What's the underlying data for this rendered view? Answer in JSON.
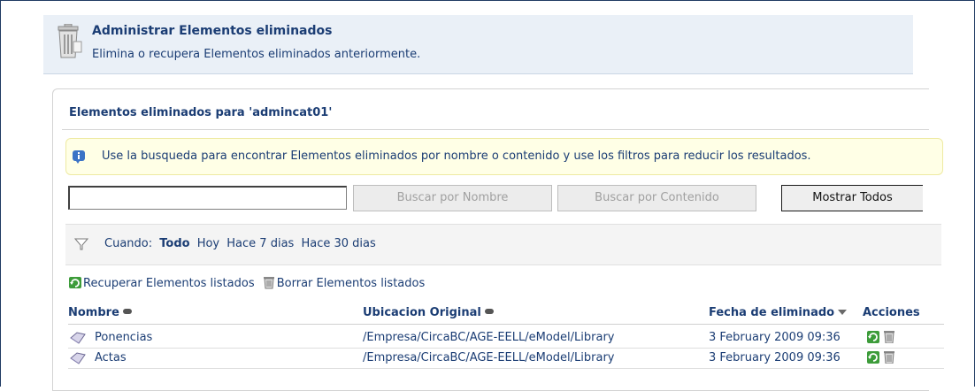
{
  "header": {
    "title": "Administrar Elementos eliminados",
    "description": "Elimina o recupera Elementos eliminados anteriormente."
  },
  "panel": {
    "title": "Elementos eliminados para 'admincat01'",
    "info": "Use la busqueda para encontrar Elementos eliminados por nombre o contenido y use los filtros para reducir los resultados."
  },
  "search": {
    "value": "",
    "by_name_label": "Buscar por Nombre",
    "by_content_label": "Buscar por Contenido",
    "show_all_label": "Mostrar Todos"
  },
  "filter": {
    "label": "Cuando:",
    "options": [
      "Todo",
      "Hoy",
      "Hace 7 dias",
      "Hace 30 dias"
    ],
    "active": "Todo"
  },
  "bulk_actions": {
    "recover": "Recuperar Elementos listados",
    "delete": "Borrar Elementos listados"
  },
  "table": {
    "columns": [
      "Nombre",
      "Ubicacion Original",
      "Fecha de eliminado",
      "Acciones"
    ],
    "sorted_by": "Fecha de eliminado",
    "rows": [
      {
        "name": "Ponencias",
        "location": "/Empresa/CircaBC/AGE-EELL/eModel/Library",
        "date": "3 February 2009 09:36"
      },
      {
        "name": "Actas",
        "location": "/Empresa/CircaBC/AGE-EELL/eModel/Library",
        "date": "3 February 2009 09:36"
      }
    ]
  },
  "icons": {
    "header": "trash-bin-icon",
    "info": "info-icon",
    "filter": "filter-funnel-icon",
    "recover": "recover-icon",
    "delete": "trash-icon",
    "space": "folder-space-icon"
  },
  "colors": {
    "accent": "#1b3d74",
    "header_bg": "#eaf0f7",
    "info_bg": "#ffffe6",
    "recover_green": "#3d9c3a"
  }
}
